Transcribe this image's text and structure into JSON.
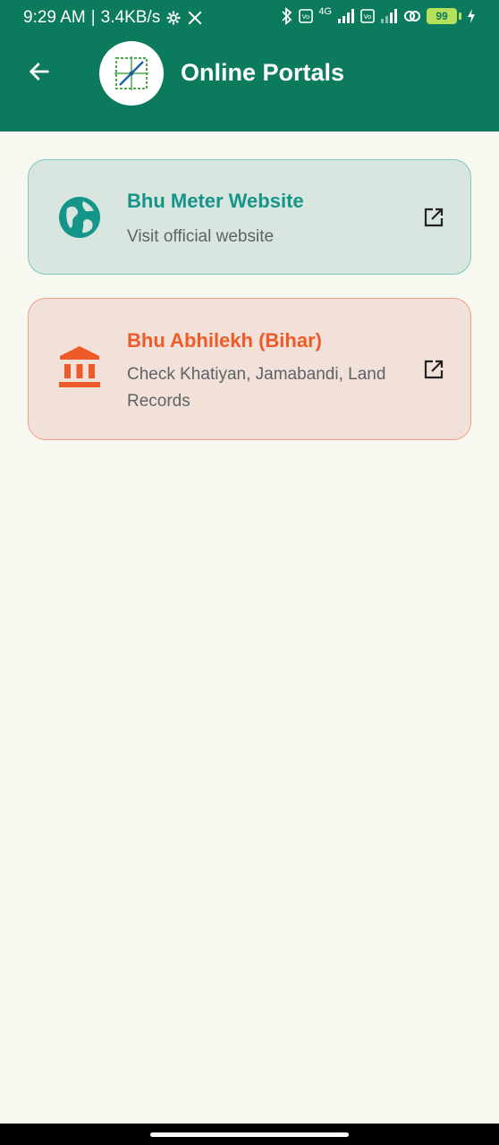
{
  "status_bar": {
    "time": "9:29 AM",
    "net_speed": "3.4KB/s",
    "network_type": "4G",
    "battery_level": "99",
    "icons": [
      "gear-icon",
      "x-logo-icon",
      "bluetooth-icon",
      "volte-icon",
      "signal-icon",
      "hotspot-icon",
      "battery-icon",
      "charging-icon"
    ]
  },
  "header": {
    "title": "Online Portals",
    "back_icon": "arrow-left-icon",
    "background_color": "#0c7a5c"
  },
  "portals": [
    {
      "title": "Bhu Meter Website",
      "subtitle": "Visit official website",
      "icon": "globe-icon",
      "action_icon": "open-in-new-icon",
      "accent_color": "#15958a"
    },
    {
      "title": "Bhu Abhilekh (Bihar)",
      "subtitle": "Check Khatiyan, Jamabandi, Land Records",
      "icon": "bank-building-icon",
      "action_icon": "open-in-new-icon",
      "accent_color": "#f05a28"
    }
  ]
}
